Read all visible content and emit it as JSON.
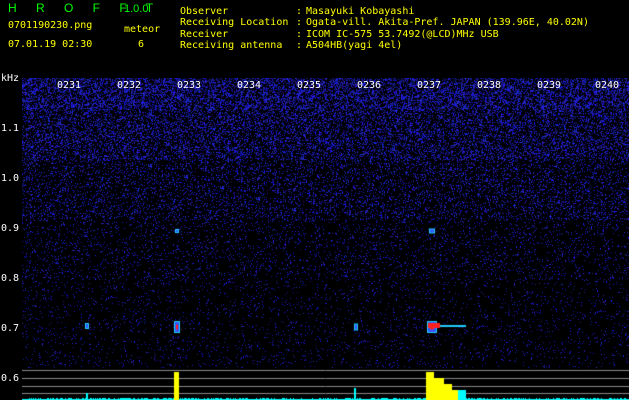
{
  "header": {
    "app_name": "H R O F F T",
    "version": "1.0.0",
    "filename": "0701190230.png",
    "meteor_label": "meteor",
    "datetime": "07.01.19 02:30",
    "meteor_count": "6"
  },
  "station_info": [
    {
      "label": "Observer",
      "value": "Masayuki Kobayashi"
    },
    {
      "label": "Receiving Location",
      "value": "Ogata-vill. Akita-Pref. JAPAN (139.96E, 40.02N)"
    },
    {
      "label": "Receiver",
      "value": "ICOM IC-575 53.7492(@LCD)MHz USB"
    },
    {
      "label": "Receiving antenna",
      "value": "A504HB(yagi 4el)"
    }
  ],
  "separator": ":",
  "spectrogram": {
    "freq_unit": "kHz",
    "freq_labels": [
      "1.1",
      "1.0",
      "0.9",
      "0.8",
      "0.7",
      "0.6"
    ],
    "time_labels": [
      "0231",
      "0232",
      "0233",
      "0234",
      "0235",
      "0236",
      "0237",
      "0238",
      "0239",
      "0240"
    ]
  },
  "colors": {
    "title": "#00ff00",
    "info_text": "#ffff00",
    "labels": "#ffffff",
    "noise": "#1c1cc8",
    "echo_core": "#ff2020",
    "echo_halo": "#22ccff",
    "level_bar": "#ffff00",
    "level_base": "#00ffff"
  }
}
